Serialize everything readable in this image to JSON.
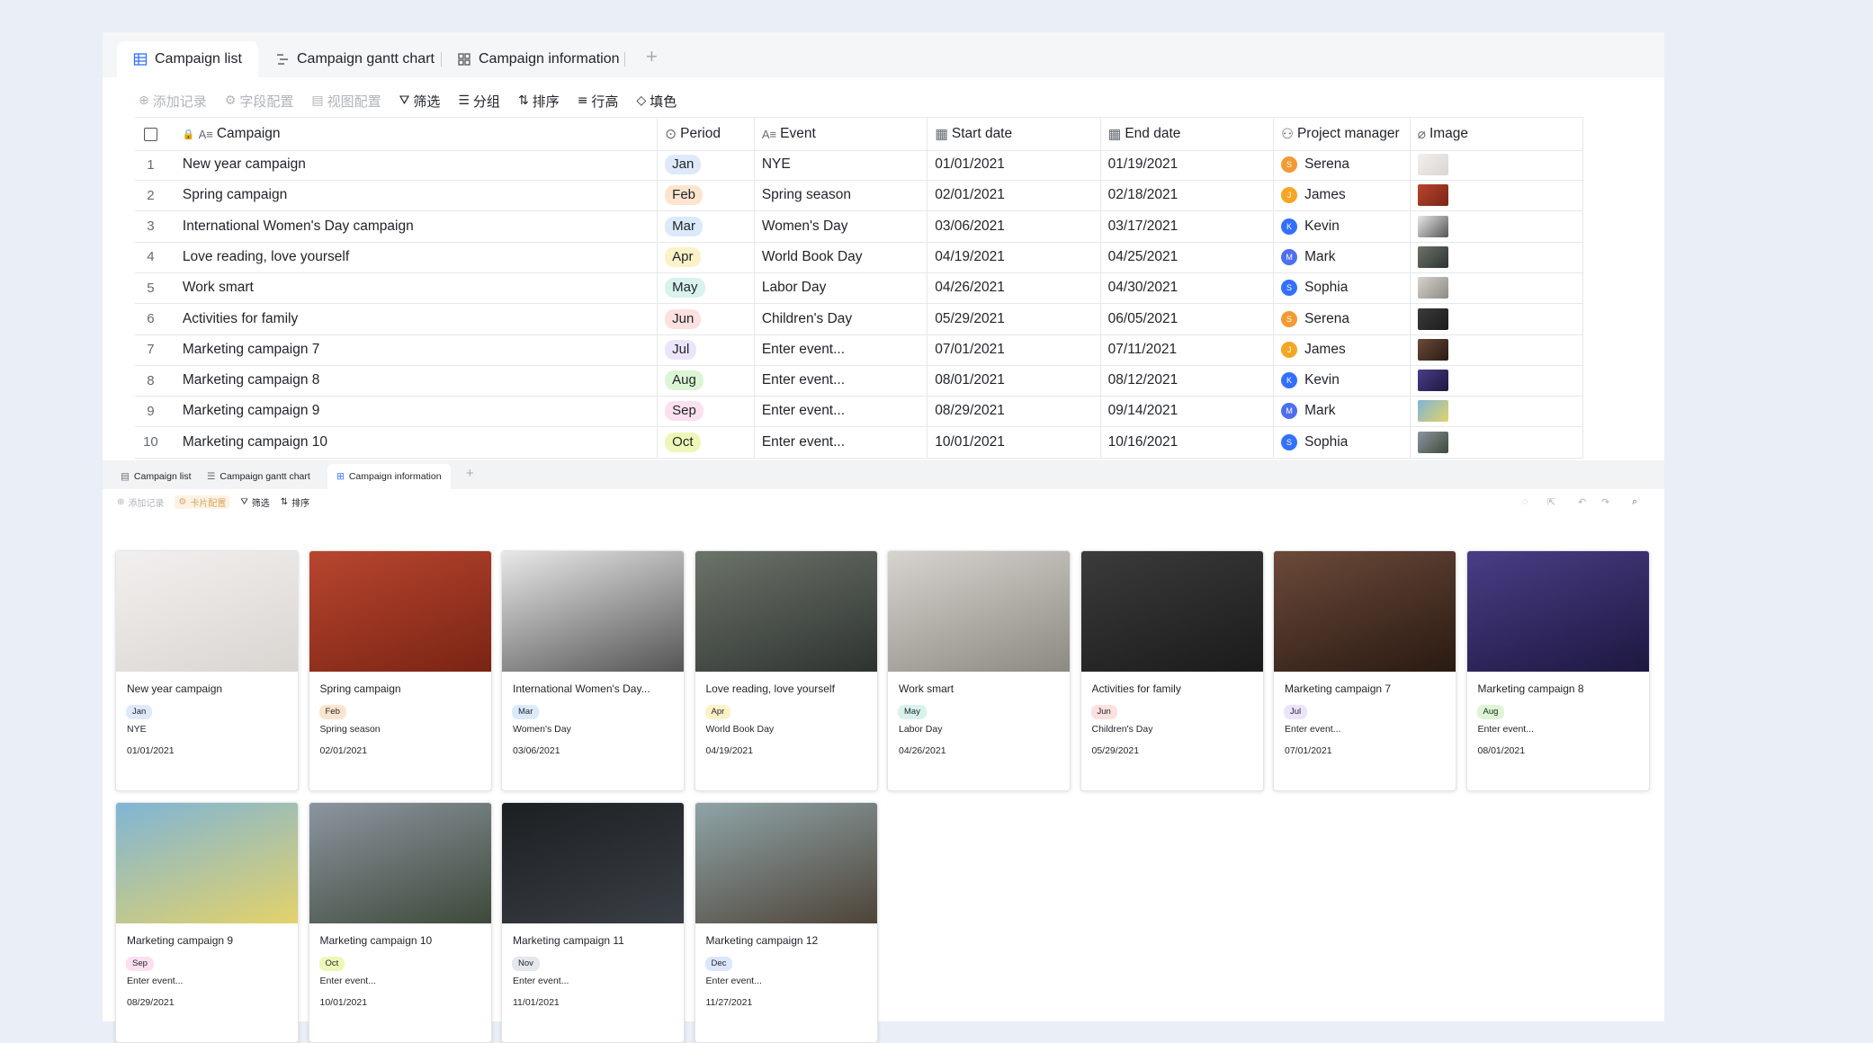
{
  "tabs": [
    {
      "label": "Campaign list",
      "active": true
    },
    {
      "label": "Campaign gantt chart",
      "active": false
    },
    {
      "label": "Campaign information",
      "active": false
    }
  ],
  "toolbar": {
    "add_record": "添加记录",
    "field_config": "字段配置",
    "view_config": "视图配置",
    "filter": "筛选",
    "group": "分组",
    "sort": "排序",
    "row_height": "行高",
    "fill": "填色"
  },
  "columns": [
    "Campaign",
    "Period",
    "Event",
    "Start date",
    "End date",
    "Project manager",
    "Image"
  ],
  "rows": [
    {
      "n": "1",
      "campaign": "New year campaign",
      "period": "Jan",
      "event": "NYE",
      "start": "01/01/2021",
      "end": "01/19/2021",
      "pm": "Serena"
    },
    {
      "n": "2",
      "campaign": "Spring campaign",
      "period": "Feb",
      "event": "Spring season",
      "start": "02/01/2021",
      "end": "02/18/2021",
      "pm": "James"
    },
    {
      "n": "3",
      "campaign": "International Women's Day campaign",
      "period": "Mar",
      "event": "Women's Day",
      "start": "03/06/2021",
      "end": "03/17/2021",
      "pm": "Kevin"
    },
    {
      "n": "4",
      "campaign": "Love reading, love yourself",
      "period": "Apr",
      "event": "World Book Day",
      "start": "04/19/2021",
      "end": "04/25/2021",
      "pm": "Mark"
    },
    {
      "n": "5",
      "campaign": "Work smart",
      "period": "May",
      "event": "Labor Day",
      "start": "04/26/2021",
      "end": "04/30/2021",
      "pm": "Sophia"
    },
    {
      "n": "6",
      "campaign": "Activities for family",
      "period": "Jun",
      "event": "Children's Day",
      "start": "05/29/2021",
      "end": "06/05/2021",
      "pm": "Serena"
    },
    {
      "n": "7",
      "campaign": "Marketing campaign 7",
      "period": "Jul",
      "event": "Enter event...",
      "start": "07/01/2021",
      "end": "07/11/2021",
      "pm": "James"
    },
    {
      "n": "8",
      "campaign": "Marketing campaign 8",
      "period": "Aug",
      "event": "Enter event...",
      "start": "08/01/2021",
      "end": "08/12/2021",
      "pm": "Kevin"
    },
    {
      "n": "9",
      "campaign": "Marketing campaign 9",
      "period": "Sep",
      "event": "Enter event...",
      "start": "08/29/2021",
      "end": "09/14/2021",
      "pm": "Mark"
    },
    {
      "n": "10",
      "campaign": "Marketing campaign 10",
      "period": "Oct",
      "event": "Enter event...",
      "start": "10/01/2021",
      "end": "10/16/2021",
      "pm": "Sophia"
    }
  ],
  "gallery_tabs": [
    {
      "label": "Campaign list"
    },
    {
      "label": "Campaign gantt chart"
    },
    {
      "label": "Campaign information"
    }
  ],
  "gallery_toolbar": {
    "add_record": "添加记录",
    "card_config": "卡片配置",
    "filter": "筛选",
    "sort": "排序"
  },
  "cards": [
    {
      "title": "New year campaign",
      "period": "Jan",
      "event": "NYE",
      "date": "01/01/2021"
    },
    {
      "title": "Spring campaign",
      "period": "Feb",
      "event": "Spring season",
      "date": "02/01/2021"
    },
    {
      "title": "International Women's Day...",
      "period": "Mar",
      "event": "Women's Day",
      "date": "03/06/2021"
    },
    {
      "title": "Love reading, love yourself",
      "period": "Apr",
      "event": "World Book Day",
      "date": "04/19/2021"
    },
    {
      "title": "Work smart",
      "period": "May",
      "event": "Labor Day",
      "date": "04/26/2021"
    },
    {
      "title": "Activities for family",
      "period": "Jun",
      "event": "Children's Day",
      "date": "05/29/2021"
    },
    {
      "title": "Marketing campaign 7",
      "period": "Jul",
      "event": "Enter event...",
      "date": "07/01/2021"
    },
    {
      "title": "Marketing campaign 8",
      "period": "Aug",
      "event": "Enter event...",
      "date": "08/01/2021"
    },
    {
      "title": "Marketing campaign 9",
      "period": "Sep",
      "event": "Enter event...",
      "date": "08/29/2021"
    },
    {
      "title": "Marketing campaign 10",
      "period": "Oct",
      "event": "Enter event...",
      "date": "10/01/2021"
    },
    {
      "title": "Marketing campaign 11",
      "period": "Nov",
      "event": "Enter event...",
      "date": "11/01/2021"
    },
    {
      "title": "Marketing campaign 12",
      "period": "Dec",
      "event": "Enter event...",
      "date": "11/27/2021"
    }
  ],
  "period_colors": {
    "Jan": "#dfe9fb",
    "Feb": "#fde4cf",
    "Mar": "#dbeafa",
    "Apr": "#fdf1c7",
    "May": "#d8f2ee",
    "Jun": "#fde0e0",
    "Jul": "#ece4fb",
    "Aug": "#dcf5d4",
    "Sep": "#fbe0ef",
    "Oct": "#eef7b8",
    "Nov": "#e4e7ec",
    "Dec": "#dde7fb"
  },
  "pm_colors": {
    "Serena": "#f39a32",
    "James": "#f5a623",
    "Kevin": "#3370ff",
    "Mark": "#4e6ef2",
    "Sophia": "#3370ff"
  },
  "image_names": [
    "new-year-letters",
    "red-door-seal",
    "woman-subway",
    "open-book-forest",
    "laptop-desk",
    "child-reading",
    "concert-hands",
    "concert-crowd",
    "color-festival",
    "camping-festival",
    "concert-confetti",
    "festival-friends"
  ],
  "image_colors": [
    [
      "#f2f0ee",
      "#d9d5d1"
    ],
    [
      "#b8462f",
      "#7a2414"
    ],
    [
      "#e8e8e8",
      "#555555"
    ],
    [
      "#6c7369",
      "#2e3330"
    ],
    [
      "#d7d3ce",
      "#8d8983"
    ],
    [
      "#3b3b3b",
      "#1b1b1b"
    ],
    [
      "#6b4a3a",
      "#2a1a12"
    ],
    [
      "#4a3d86",
      "#1d1840"
    ],
    [
      "#7fb5d6",
      "#e3d26a"
    ],
    [
      "#8c95a0",
      "#3d4a3a"
    ],
    [
      "#1c1f22",
      "#3a3f45"
    ],
    [
      "#8fa4a8",
      "#4e4438"
    ]
  ]
}
